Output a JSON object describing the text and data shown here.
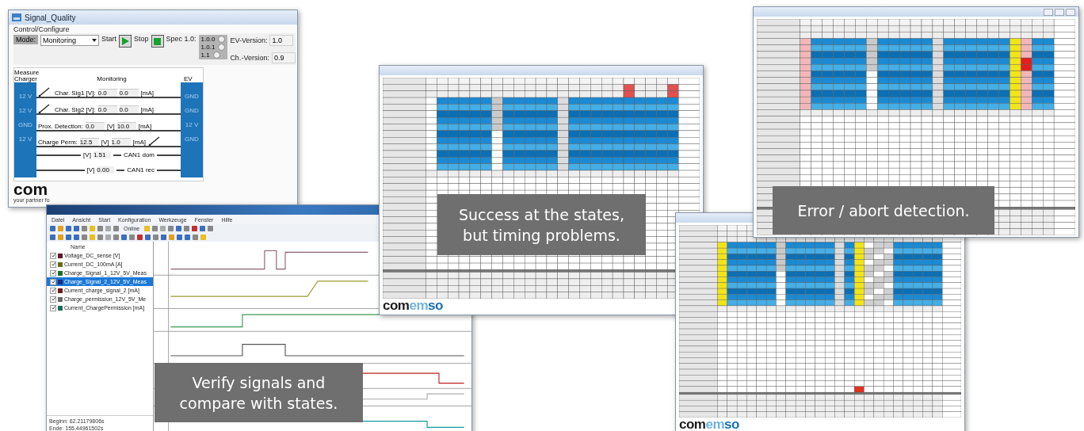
{
  "signal_quality": {
    "title": "Signal_Quality",
    "group_title": "Control/Configure",
    "mode_label": "Mode:",
    "mode_value": "Monitoring",
    "start_label": "Start",
    "stop_label": "Stop",
    "spec_label": "Spec 1.0:",
    "spec_options": [
      {
        "label": "1.0.0",
        "selected": false
      },
      {
        "label": "1.0.1",
        "selected": false
      },
      {
        "label": "1.1",
        "selected": false
      }
    ],
    "versions": [
      {
        "label": "EV-Version:",
        "value": "1.0"
      },
      {
        "label": "Ch.-Version:",
        "value": "0.9"
      }
    ],
    "charger_title": "Measure Charger",
    "monitor_title": "Monitoring",
    "ev_title": "EV",
    "left_pins": [
      "12 V",
      "12 V",
      "GND",
      "12 V"
    ],
    "right_pins": [
      "GND",
      "GND",
      "12 V",
      "GND"
    ],
    "rows": [
      {
        "kind": "signal",
        "label": "Char. Sig1 [V]:",
        "switch_left": true,
        "switch_right": false,
        "fields": [
          {
            "kind": "value",
            "text": "0.0"
          },
          {
            "kind": "value",
            "text": "0.0"
          },
          {
            "kind": "unit",
            "text": "[mA]"
          }
        ]
      },
      {
        "kind": "signal",
        "label": "Char. Sig2 [V]:",
        "switch_left": true,
        "switch_right": false,
        "fields": [
          {
            "kind": "value",
            "text": "0.0"
          },
          {
            "kind": "value",
            "text": "0.0"
          },
          {
            "kind": "unit",
            "text": "[mA]"
          }
        ]
      },
      {
        "kind": "signal",
        "label": "Prox. Detection:",
        "switch_left": false,
        "switch_right": false,
        "fields": [
          {
            "kind": "value",
            "text": "0.0"
          },
          {
            "kind": "unit",
            "text": "[V]"
          },
          {
            "kind": "value",
            "text": "10.0"
          },
          {
            "kind": "unit",
            "text": "[mA]"
          }
        ]
      },
      {
        "kind": "signal",
        "label": "Charge Perm:",
        "switch_left": false,
        "switch_right": true,
        "fields": [
          {
            "kind": "value",
            "text": "12.5"
          },
          {
            "kind": "unit",
            "text": "[V]"
          },
          {
            "kind": "value",
            "text": "1.0"
          },
          {
            "kind": "unit",
            "text": "[mA]"
          }
        ]
      },
      {
        "kind": "bus",
        "label": "CAN1 dom",
        "unit": "[V]",
        "value": "1.51"
      },
      {
        "kind": "bus",
        "label": "CAN1 rec",
        "unit": "[V]",
        "value": "0.00"
      }
    ],
    "logo": "com",
    "tagline": "your partner fo"
  },
  "plot_window": {
    "menu": [
      "Datei",
      "Ansicht",
      "Start",
      "Konfiguration",
      "Werkzeuge",
      "Fenster",
      "Hilfe"
    ],
    "online_label": "Online",
    "list_header": "Name",
    "channels": [
      {
        "name": "Voltage_DC_sense [V]",
        "color": "#5a1a2a",
        "checked": true,
        "selected": false
      },
      {
        "name": "Current_DC_100mA [A]",
        "color": "#6b6a1a",
        "checked": true,
        "selected": false
      },
      {
        "name": "Charge_Signal_1_12V_5V_Meas",
        "color": "#1f6b2a",
        "checked": true,
        "selected": false
      },
      {
        "name": "Charge_Signal_2_12V_5V_Meas",
        "color": "#1a2f7a",
        "checked": true,
        "selected": true
      },
      {
        "name": "Current_charge_signal_2 [mA]",
        "color": "#6b1a1a",
        "checked": true,
        "selected": false
      },
      {
        "name": "Charge_permission_12V_5V_Me",
        "color": "#6a6a6a",
        "checked": true,
        "selected": false
      },
      {
        "name": "Current_ChargePermission [mA]",
        "color": "#1a6b5a",
        "checked": true,
        "selected": false
      }
    ],
    "footer": [
      "Beginn: 62.21179806s",
      "Ende: 155.44961502s"
    ]
  },
  "tables": [
    {
      "kind": "timing",
      "logo": [
        {
          "kind": "dark",
          "text": "com"
        },
        {
          "kind": "light",
          "text": "em"
        },
        {
          "kind": "accent",
          "text": "so"
        }
      ]
    },
    {
      "kind": "error"
    },
    {
      "kind": "abort",
      "logo": [
        {
          "kind": "dark",
          "text": "com"
        },
        {
          "kind": "light",
          "text": "em"
        },
        {
          "kind": "accent",
          "text": "so"
        }
      ]
    }
  ],
  "captions": [
    {
      "lines": [
        "Success at the states,",
        "but timing problems."
      ]
    },
    {
      "lines": [
        "Verify signals and",
        "compare with states."
      ]
    },
    {
      "lines": [
        "Error / abort detection."
      ]
    }
  ]
}
